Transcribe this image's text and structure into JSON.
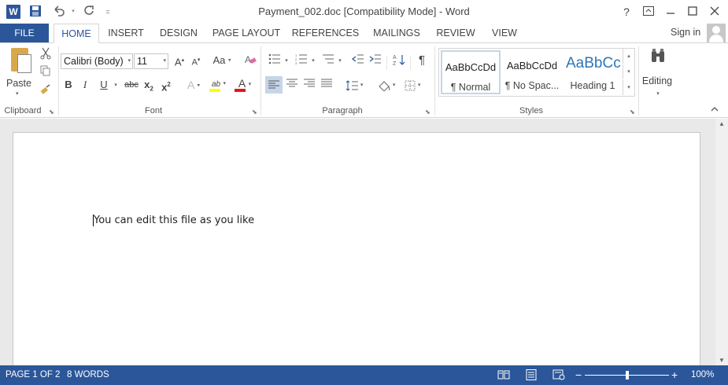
{
  "title_bar": {
    "app_icon": "W",
    "document_title": "Payment_002.doc [Compatibility Mode] - Word",
    "quick_access": [
      "save-icon",
      "undo-icon",
      "redo-icon",
      "customize-icon"
    ],
    "help": "?"
  },
  "tabs": {
    "file": "FILE",
    "items": [
      "HOME",
      "INSERT",
      "DESIGN",
      "PAGE LAYOUT",
      "REFERENCES",
      "MAILINGS",
      "REVIEW",
      "VIEW"
    ],
    "active": "HOME",
    "sign_in": "Sign in"
  },
  "ribbon": {
    "clipboard": {
      "label": "Clipboard",
      "paste": "Paste"
    },
    "font": {
      "label": "Font",
      "font_name": "Calibri (Body)",
      "font_size": "11",
      "grow": "A",
      "shrink": "A",
      "change_case": "Aa",
      "bold": "B",
      "italic": "I",
      "underline": "U",
      "strike": "abc",
      "subscript": "x",
      "subscript_mark": "2",
      "superscript": "x",
      "superscript_mark": "2",
      "text_effects": "A",
      "highlight": "ab",
      "font_color": "A",
      "highlight_color": "#ffff00",
      "font_color_value": "#e81123"
    },
    "paragraph": {
      "label": "Paragraph",
      "pilcrow": "¶"
    },
    "styles": {
      "label": "Styles",
      "items": [
        {
          "sample": "AaBbCcDd",
          "name": "¶ Normal"
        },
        {
          "sample": "AaBbCcDd",
          "name": "¶ No Spac..."
        },
        {
          "sample": "AaBbCc",
          "name": "Heading 1"
        }
      ]
    },
    "editing": {
      "label": "Editing"
    }
  },
  "document": {
    "text": "You can edit this file as you like"
  },
  "status_bar": {
    "page": "PAGE 1 OF 2",
    "words": "8 WORDS",
    "zoom_out": "−",
    "zoom_in": "+",
    "zoom": "100%",
    "zoom_fraction": 0.5
  }
}
